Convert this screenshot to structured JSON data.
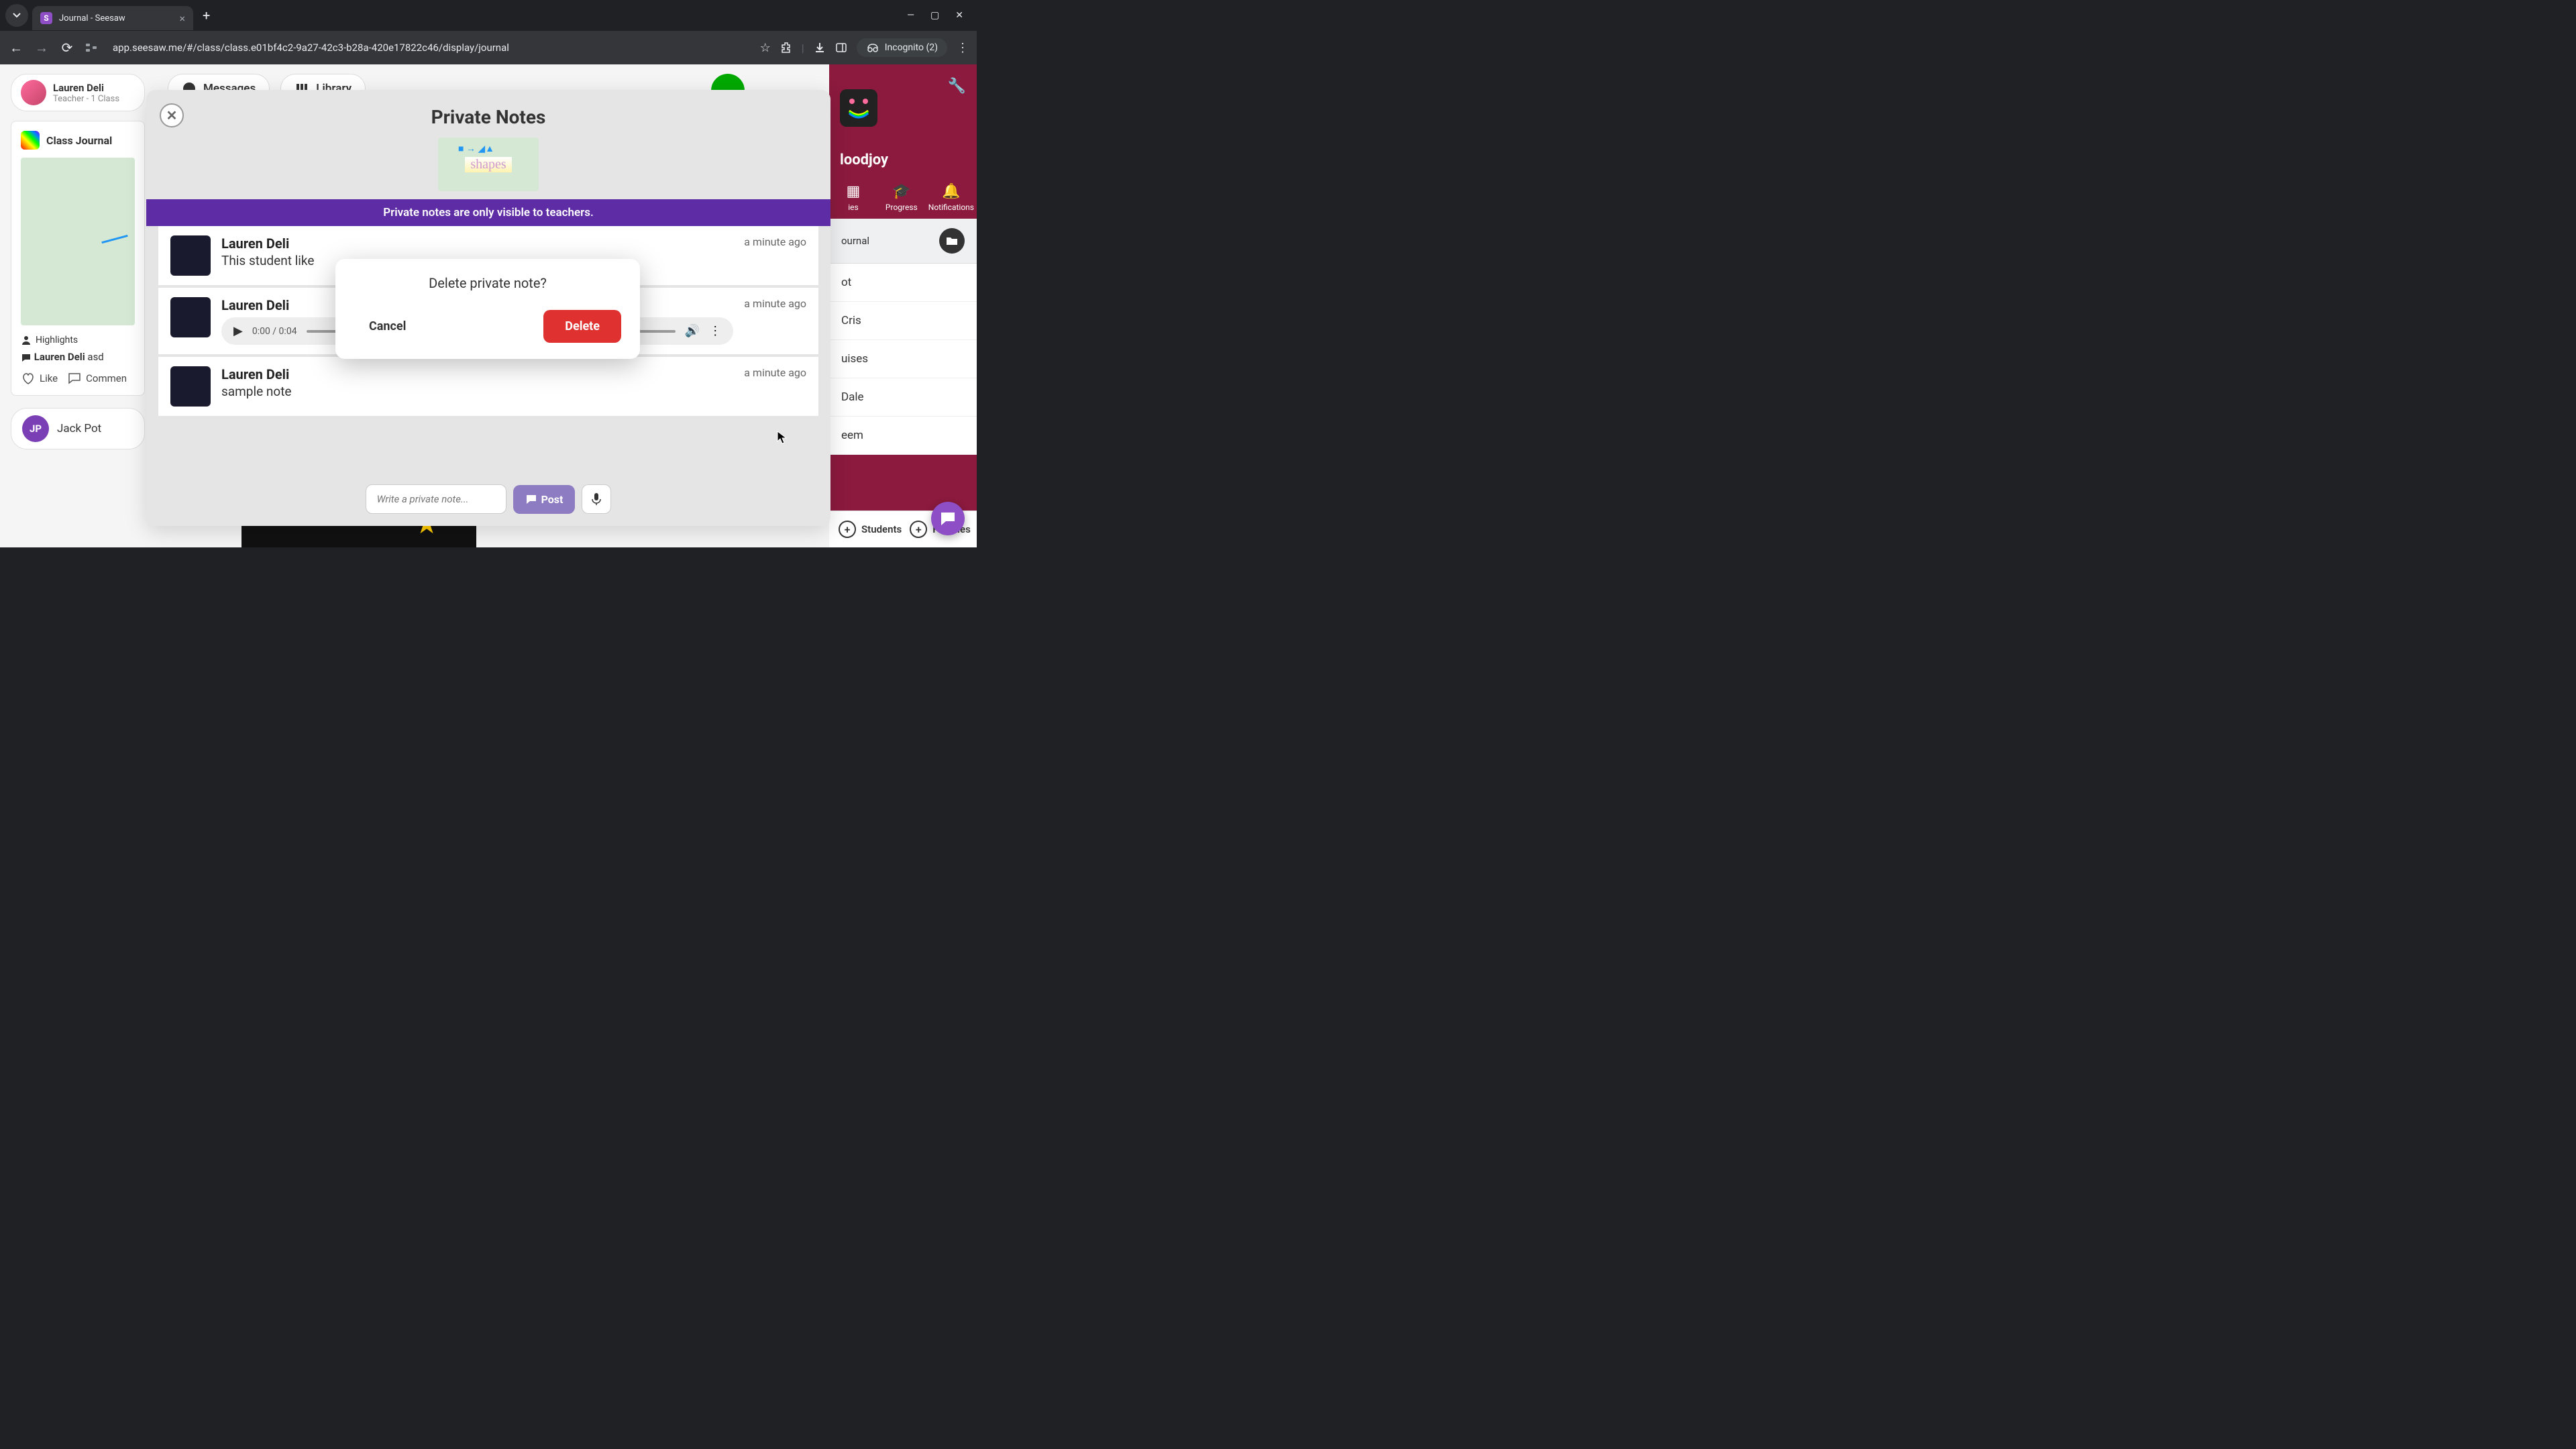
{
  "browser": {
    "tab_title": "Journal - Seesaw",
    "url": "app.seesaw.me/#/class/class.e01bf4c2-9a27-42c3-b28a-420e17822c46/display/journal",
    "incognito_label": "Incognito (2)"
  },
  "user": {
    "name": "Lauren Deli",
    "role": "Teacher - 1 Class"
  },
  "journal": {
    "title": "Class Journal",
    "highlights_label": "Highlights",
    "commenter": "Lauren Deli",
    "comment_suffix": "asd",
    "like_label": "Like",
    "comment_label": "Commen"
  },
  "student": {
    "initials": "JP",
    "name": "Jack Pot"
  },
  "top_nav": {
    "messages": "Messages",
    "library": "Library"
  },
  "right": {
    "class_name": "loodjoy",
    "tab_activities": "ies",
    "tab_progress": "Progress",
    "tab_notifications": "Notifications",
    "list_header": "ournal",
    "items": [
      "ot",
      "Cris",
      "uises",
      "Dale",
      "eem"
    ],
    "footer_students": "Students",
    "footer_families": "Families"
  },
  "notes_modal": {
    "title": "Private Notes",
    "thumb_label": "shapes",
    "banner": "Private notes are only visible to teachers.",
    "notes": [
      {
        "author": "Lauren Deli",
        "text": "This student like",
        "time": "a minute ago"
      },
      {
        "author": "Lauren Deli",
        "audio_time": "0:00 / 0:04",
        "time": "a minute ago"
      },
      {
        "author": "Lauren Deli",
        "text": "sample note",
        "time": "a minute ago"
      }
    ],
    "input_placeholder": "Write a private note...",
    "post_label": "Post"
  },
  "confirm": {
    "title": "Delete private note?",
    "cancel": "Cancel",
    "delete": "Delete"
  }
}
